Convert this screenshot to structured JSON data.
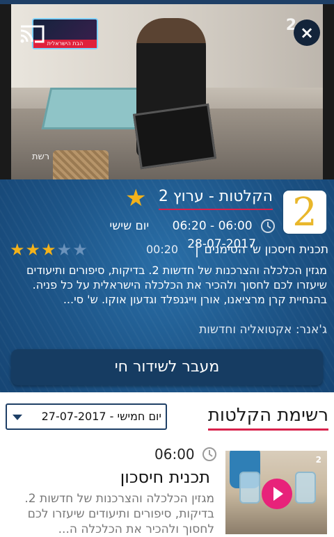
{
  "player": {
    "close_label": "×",
    "video_logo_text": "הבת הישראלית",
    "video_channel_mark": "2",
    "video_brand": "רשת"
  },
  "info": {
    "channel_logo_char": "2",
    "title": "הקלטות - ערוץ 2",
    "time_range": "06:00 - 06:20",
    "day": "יום שישי",
    "date": "28-07-2017",
    "program_name": "תכנית חיסכון ש' הסימנים",
    "duration": "00:20",
    "rating": 3,
    "rating_max": 5,
    "description": "מגזין הכלכלה והצרכנות של חדשות 2. בדיקות, סיפורים ותיעודים שיעזרו לכם לחסוך ולהכיר את הכלכלה הישראלית על כל פניה. בהנחיית קרן מרציאנו, אורן וייגנפלד וגדעון אוקו. ש' סי...",
    "genre": "ג'אנר: אקטואליה וחדשות",
    "live_button": "מעבר לשידור חי"
  },
  "list": {
    "title": "רשימת הקלטות",
    "selected_date": "יום חמישי - 27-07-2017"
  },
  "episodes": [
    {
      "time": "06:00",
      "title": "תכנית חיסכון",
      "thumb_channel": "2",
      "description": "מגזין הכלכלה והצרכנות של חדשות 2. בדיקות, סיפורים ותיעודים שיעזרו לכם לחסוך ולהכיר את הכלכלה ה..."
    }
  ],
  "colors": {
    "accent_red": "#d9204b",
    "star_gold": "#f3b21b",
    "panel_blue": "#1d5588",
    "button_dark": "#163c62"
  },
  "icons": {
    "cast": "cast-icon",
    "close": "close-icon",
    "clock": "clock-icon",
    "star": "star-icon",
    "dropdown": "chevron-down-icon",
    "play": "play-icon"
  }
}
